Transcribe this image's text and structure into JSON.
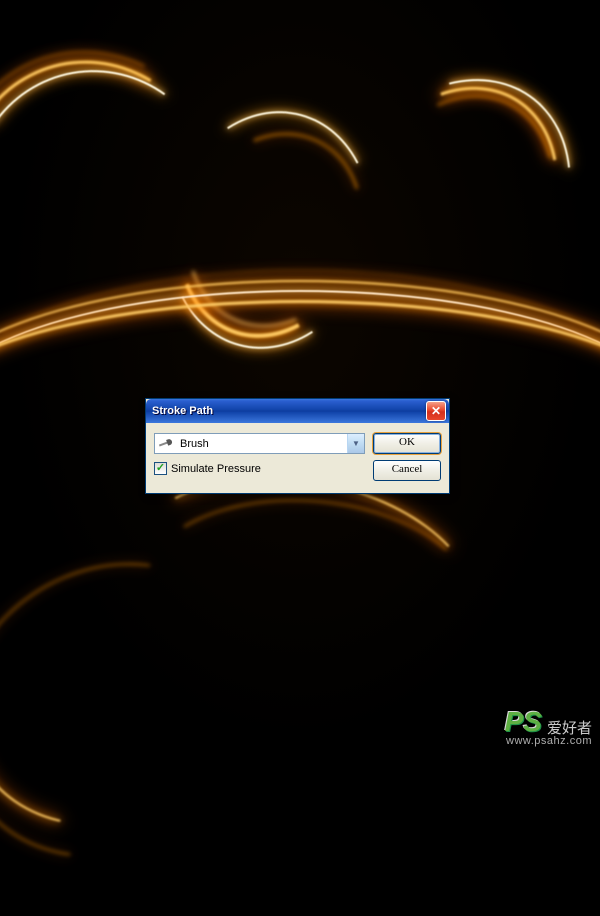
{
  "dialog": {
    "title": "Stroke Path",
    "tool_selected": "Brush",
    "simulate_pressure_label": "Simulate Pressure",
    "simulate_pressure_checked": true,
    "ok_label": "OK",
    "cancel_label": "Cancel",
    "close_glyph": "✕"
  },
  "watermark": {
    "logo_text": "PS",
    "cn_text": "爱好者",
    "url": "www.psahz.com"
  }
}
